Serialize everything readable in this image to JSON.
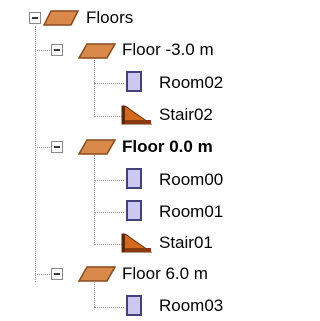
{
  "tree": {
    "root": {
      "label": "Floors",
      "icon": "floor-icon",
      "expanded": true
    },
    "floors": [
      {
        "label": "Floor -3.0 m",
        "bold": false,
        "icon": "floor-icon",
        "expanded": true,
        "children": [
          {
            "label": "Room02",
            "icon": "room-icon"
          },
          {
            "label": "Stair02",
            "icon": "stair-icon"
          }
        ]
      },
      {
        "label": "Floor 0.0 m",
        "bold": true,
        "icon": "floor-icon",
        "expanded": true,
        "children": [
          {
            "label": "Room00",
            "icon": "room-icon"
          },
          {
            "label": "Room01",
            "icon": "room-icon"
          },
          {
            "label": "Stair01",
            "icon": "stair-icon"
          }
        ]
      },
      {
        "label": "Floor 6.0 m",
        "bold": false,
        "icon": "floor-icon",
        "expanded": true,
        "children": [
          {
            "label": "Room03",
            "icon": "room-icon"
          }
        ]
      }
    ]
  },
  "colors": {
    "floor_fill": "#d98a4a",
    "floor_edge": "#8a4a1c",
    "room_fill": "#c9c9f2",
    "room_edge": "#43437a",
    "stair_fill": "#d2691e",
    "connector": "#9a9a9a"
  }
}
